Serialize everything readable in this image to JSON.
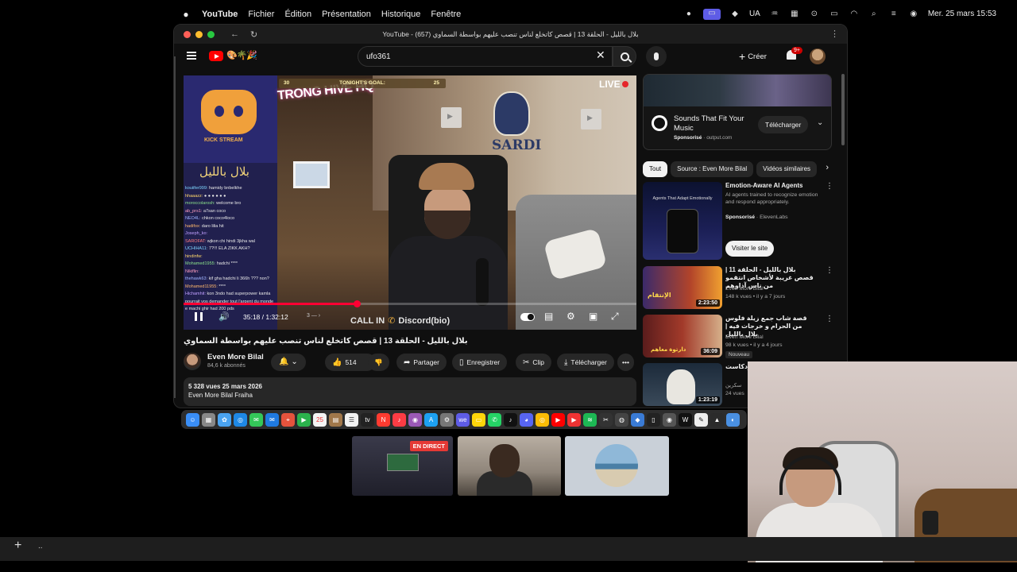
{
  "menubar": {
    "app_name": "YouTube",
    "items": [
      "Fichier",
      "Édition",
      "Présentation",
      "Historique",
      "Fenêtre"
    ],
    "status_lang": "UA",
    "datetime": "Mer. 25 mars 15:53"
  },
  "browser": {
    "window_title": "YouTube - (657) بلال بالليل - الحلقة 13 | قصص كاتخلع لناس تنصب عليهم بواسطة السماوي"
  },
  "youtube_header": {
    "search_value": "ufo361",
    "create_label": "Créer",
    "notifications_badge": "9+"
  },
  "video": {
    "live_label": "LIVE",
    "goal_label": "TONIGHT'S GOAL:",
    "goal_current": "30",
    "goal_target": "25",
    "overlay_brand": "TRONG HIVE HQ",
    "discord_caption": "KICK STREAM",
    "overlay_arabic": "بلال بالليل",
    "sardi_label": "SARDI",
    "callin_label": "CALL IN",
    "discord_label": "Discord(bio)",
    "time_display": "35:18 / 1:32:12",
    "progress_fraction": 0.383,
    "chat_lines": [
      {
        "user": "kouiifer999",
        "text": "hamidy bnbelkhe",
        "color": "#7fd6ff"
      },
      {
        "user": "hhaaazz",
        "text": "● ● ● ● ● ●",
        "color": "#ffd76a"
      },
      {
        "user": "moroccolarosh",
        "text": "welcome bro",
        "color": "#8be28b"
      },
      {
        "user": "ab_prs1",
        "text": "a7san coco",
        "color": "#ff9fbf"
      },
      {
        "user": "NEO4L",
        "text": "chkon coco4loco",
        "color": "#9fb4ff"
      },
      {
        "user": "hadifox",
        "text": "daro lilia hit",
        "color": "#ffb86b"
      },
      {
        "user": "Joseph_ko",
        "text": "",
        "color": "#c0a0ff"
      },
      {
        "user": "SAROFAT",
        "text": "wjkon chi hindi 3jkha wal",
        "color": "#ff7d7d"
      },
      {
        "user": "UCHIHA11",
        "text": "7?!!! ELA ZIKK AKH?",
        "color": "#7fd6ff"
      },
      {
        "user": "hindinfw",
        "text": "",
        "color": "#ffd76a"
      },
      {
        "user": "Mohamed1955",
        "text": "hadchi ****",
        "color": "#8be28b"
      },
      {
        "user": "Nikiflin",
        "text": "",
        "color": "#ff9fbf"
      },
      {
        "user": "thehawk63",
        "text": "kif gha hadchi li 366h ??? non?",
        "color": "#9fb4ff"
      },
      {
        "user": "Mohamed11955",
        "text": "****",
        "color": "#ffb86b"
      },
      {
        "user": "Hichamhit",
        "text": "kon 3ndo had superpower kamla",
        "color": "#c0a0ff"
      },
      {
        "user": "",
        "text": "pourrait vos demander tout l'argent du monde",
        "color": "#ff7d7d"
      },
      {
        "user": "",
        "text": "e machi ghir had 200 pds",
        "color": "#7fd6ff"
      }
    ]
  },
  "video_info": {
    "title": "بلال بالليل - الحلقة 13 | قصص كاتخلع لناس تنصب عليهم بواسطة السماوي",
    "channel_name": "Even More Bilal",
    "subscribers": "84,6 k abonnés",
    "likes": "514",
    "share_label": "Partager",
    "save_label": "Enregistrer",
    "clip_label": "Clip",
    "download_label": "Télécharger",
    "views_date": "5 328 vues  25 mars 2026",
    "description_line": "Even More Bilal Fraiha"
  },
  "sidebar": {
    "ad": {
      "title": "Sounds That Fit Your Music",
      "sponsored": "Sponsorisé",
      "domain": "output.com",
      "cta": "Télécharger"
    },
    "chips": [
      "Tout",
      "Source : Even More Bilal",
      "Vidéos similaires"
    ],
    "recommendations": [
      {
        "title": "Emotion-Aware AI Agents",
        "desc": "AI agents trained to recognize emotion and respond appropriately.",
        "sponsored": "Sponsorisé",
        "advertiser": "ElevenLabs",
        "cta": "Visiter le site",
        "thumb_caption": "Agents That Adapt Emotionally"
      },
      {
        "title": "بلال بالليل - الحلقة 11 | قصص غريبة لأشخاص انتقمو من ناس آذاوهم",
        "channel": "Even More Bilal",
        "meta": "148 k vues • il y a 7 jours",
        "duration": "2:23:50",
        "thumb_text": "الإنتقام"
      },
      {
        "title": "قصة شاب جمع زيلة فلوس من الحرام و خرجات فيه | بلال بالليل",
        "channel": "Even More Bilal",
        "meta": "98 k vues • il y a 4 jours",
        "duration": "36:09",
        "badge": "Nouveau",
        "thumb_text": "دارتوة معاهم"
      },
      {
        "title": "عبد | مع ... بودكاست",
        "channel": "سكرين",
        "meta": "24 vues",
        "duration": "1:23:19"
      }
    ]
  },
  "mini_windows": {
    "direct_badge": "EN DIRECT"
  },
  "bottom": {
    "dots": ".."
  }
}
